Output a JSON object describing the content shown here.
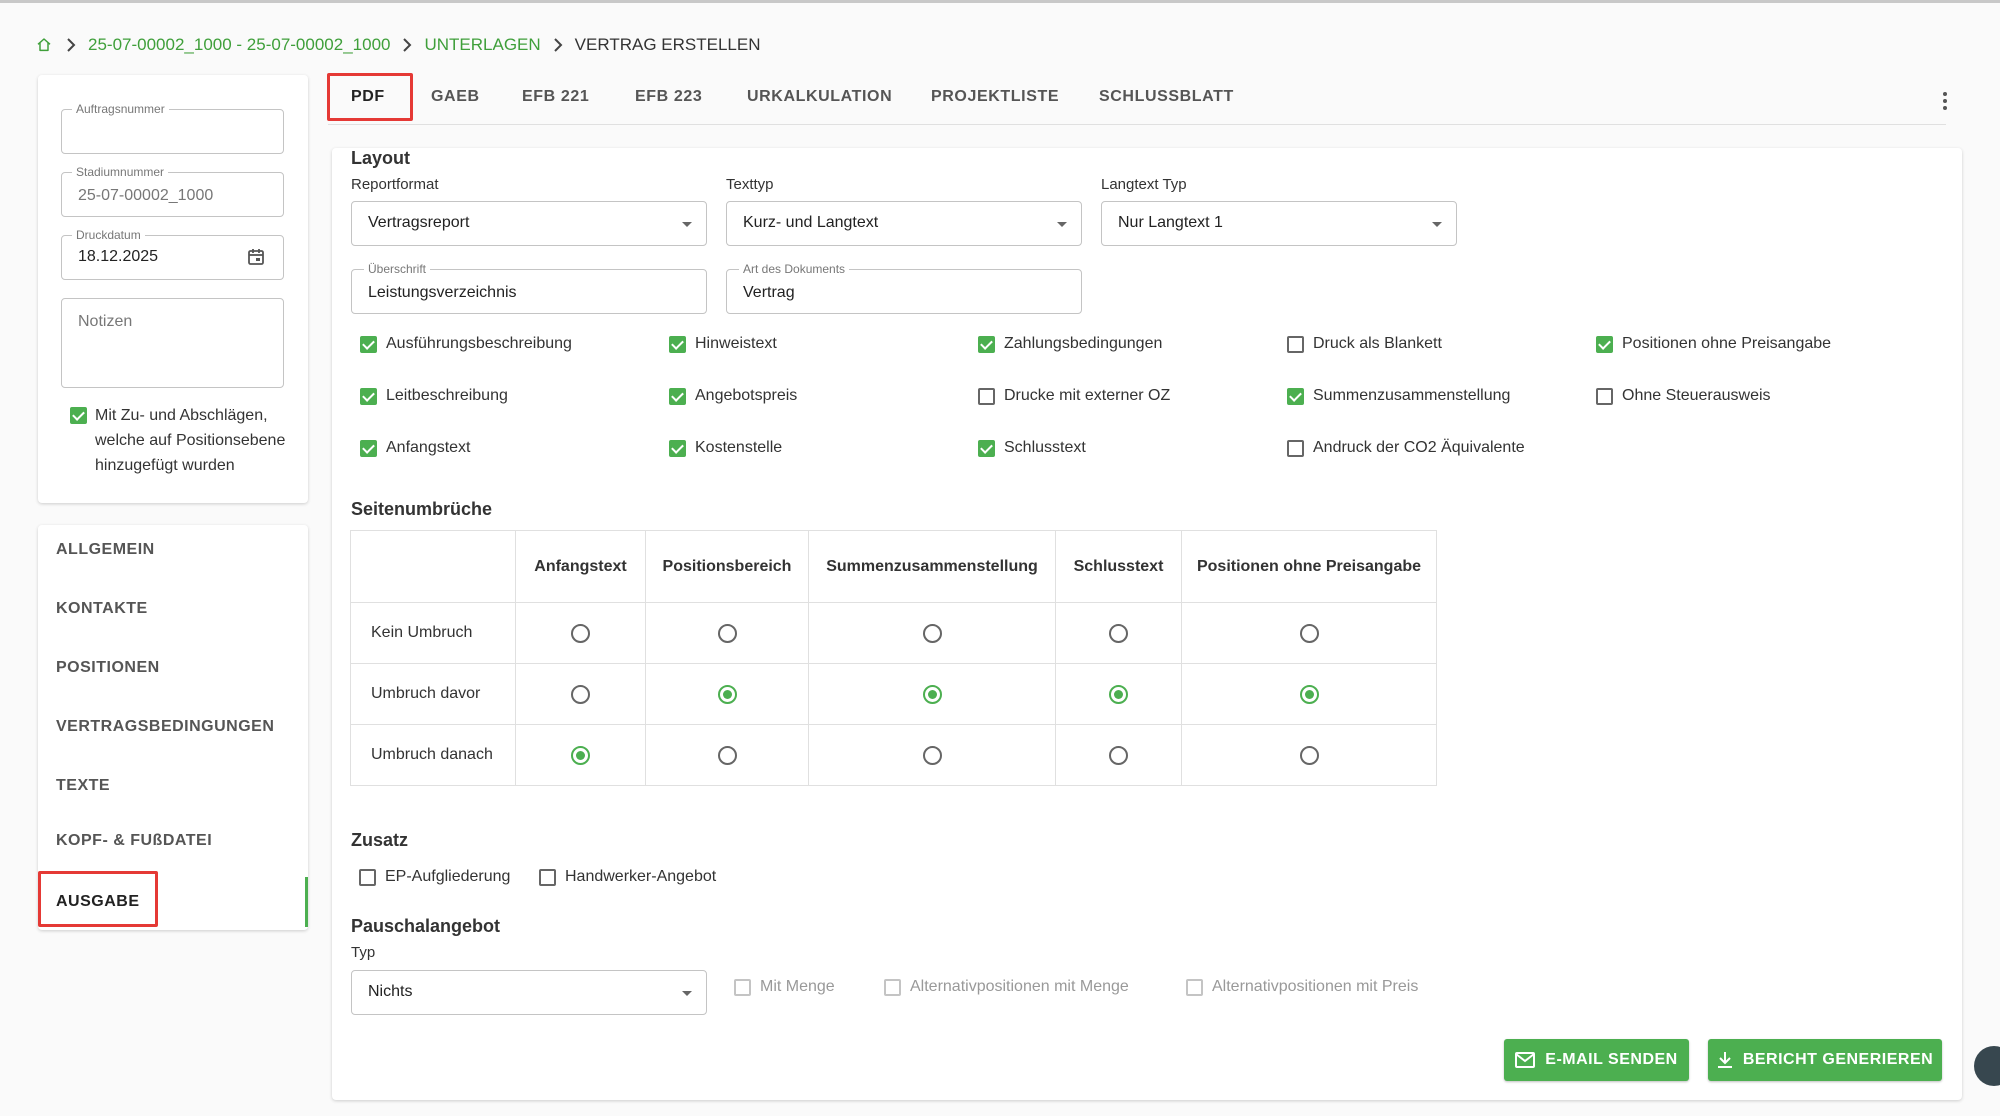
{
  "breadcrumb": {
    "item1": "25-07-00002_1000 - 25-07-00002_1000",
    "item2": "UNTERLAGEN",
    "current": "VERTRAG ERSTELLEN"
  },
  "sidebar_form": {
    "auftrag_label": "Auftragsnummer",
    "auftrag_value": "",
    "stadium_label": "Stadiumnummer",
    "stadium_value": "25-07-00002_1000",
    "druck_label": "Druckdatum",
    "druck_value": "18.12.2025",
    "notizen_placeholder": "Notizen",
    "zuschlaege_label_1": "Mit Zu- und Abschlägen,",
    "zuschlaege_label_2": "welche auf Positionsebene",
    "zuschlaege_label_3": "hinzugefügt wurden",
    "zuschlaege_checked": true
  },
  "nav": {
    "items": [
      "ALLGEMEIN",
      "KONTAKTE",
      "POSITIONEN",
      "VERTRAGSBEDINGUNGEN",
      "TEXTE",
      "KOPF- & FUßDATEI",
      "AUSGABE"
    ],
    "active": "AUSGABE"
  },
  "tabs": [
    "PDF",
    "GAEB",
    "EFB 221",
    "EFB 223",
    "URKALKULATION",
    "PROJEKTLISTE",
    "SCHLUSSBLATT"
  ],
  "active_tab": "PDF",
  "layout": {
    "heading": "Layout",
    "reportformat_label": "Reportformat",
    "reportformat_value": "Vertragsreport",
    "texttyp_label": "Texttyp",
    "texttyp_value": "Kurz- und Langtext",
    "langtext_label": "Langtext Typ",
    "langtext_value": "Nur Langtext 1",
    "ueberschrift_label": "Überschrift",
    "ueberschrift_value": "Leistungsverzeichnis",
    "artdok_label": "Art des Dokuments",
    "artdok_value": "Vertrag"
  },
  "options": [
    {
      "label": "Ausführungsbeschreibung",
      "checked": true
    },
    {
      "label": "Hinweistext",
      "checked": true
    },
    {
      "label": "Zahlungsbedingungen",
      "checked": true
    },
    {
      "label": "Druck als Blankett",
      "checked": false
    },
    {
      "label": "Positionen ohne Preisangabe",
      "checked": true
    },
    {
      "label": "Leitbeschreibung",
      "checked": true
    },
    {
      "label": "Angebotspreis",
      "checked": true
    },
    {
      "label": "Drucke mit externer OZ",
      "checked": false
    },
    {
      "label": "Summenzusammenstellung",
      "checked": true
    },
    {
      "label": "Ohne Steuerausweis",
      "checked": false
    },
    {
      "label": "Anfangstext",
      "checked": true
    },
    {
      "label": "Kostenstelle",
      "checked": true
    },
    {
      "label": "Schlusstext",
      "checked": true
    },
    {
      "label": "Andruck der CO2 Äquivalente",
      "checked": false
    }
  ],
  "seitenumbrueche": {
    "heading": "Seitenumbrüche",
    "columns": [
      "Anfangstext",
      "Positionsbereich",
      "Summenzusammenstellung",
      "Schlusstext",
      "Positionen ohne Preisangabe"
    ],
    "rows": [
      "Kein Umbruch",
      "Umbruch davor",
      "Umbruch danach"
    ],
    "selected_row_per_column": [
      2,
      1,
      1,
      1,
      1
    ]
  },
  "zusatz": {
    "heading": "Zusatz",
    "ep_label": "EP-Aufgliederung",
    "ep_checked": false,
    "hw_label": "Handwerker-Angebot",
    "hw_checked": false
  },
  "pauschal": {
    "heading": "Pauschalangebot",
    "typ_label": "Typ",
    "typ_value": "Nichts",
    "mit_menge": "Mit Menge",
    "alt_menge": "Alternativpositionen mit Menge",
    "alt_preis": "Alternativpositionen mit Preis"
  },
  "buttons": {
    "email": "E-MAIL SENDEN",
    "bericht": "BERICHT GENERIEREN"
  },
  "colors": {
    "accent": "#4caf50",
    "link": "#3f9f3a",
    "highlight": "#e53935"
  }
}
